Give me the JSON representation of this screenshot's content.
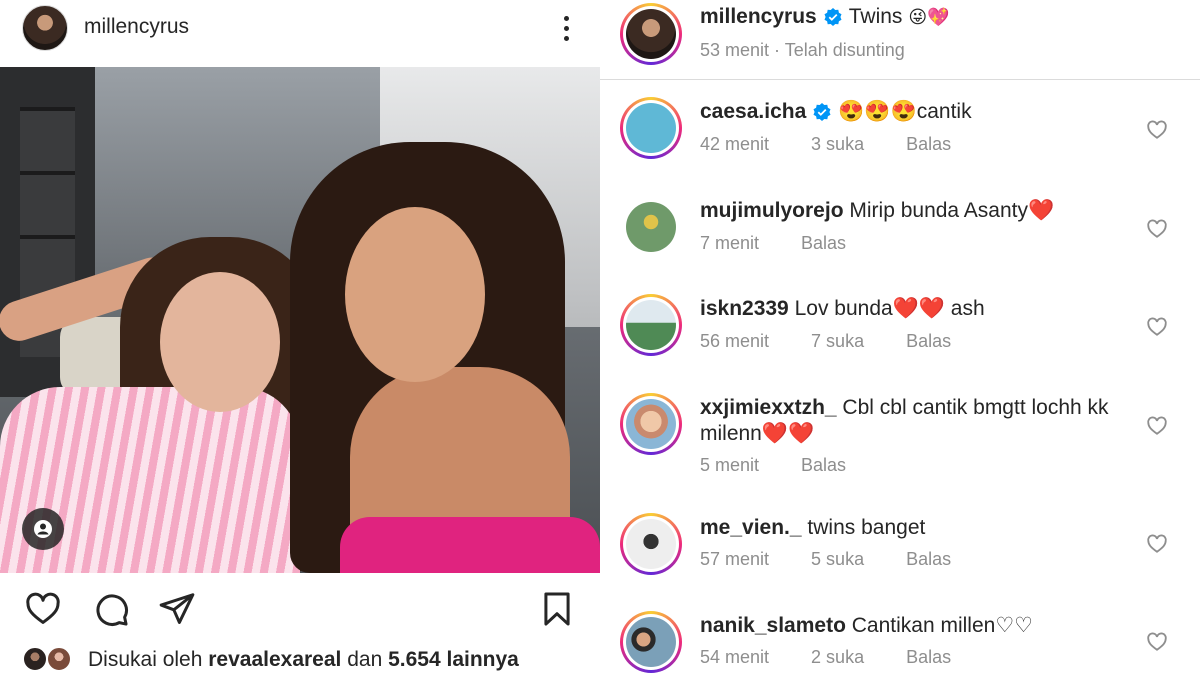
{
  "post": {
    "username": "millencyrus",
    "liked_by_prefix": "Disukai oleh ",
    "liked_by_user": "revaalexareal",
    "liked_by_conj": " dan ",
    "liked_by_count": "5.654 lainnya"
  },
  "caption": {
    "username": "millencyrus",
    "text": "Twins",
    "emojis": "😜💖",
    "meta": "53 menit · Telah disunting"
  },
  "comments": [
    {
      "username": "caesa.icha",
      "verified": true,
      "text": "😍😍😍cantik",
      "time": "42 menit",
      "likes": "3 suka",
      "reply": "Balas",
      "color": "#5fb8d6"
    },
    {
      "username": "mujimulyorejo",
      "verified": false,
      "text": "Mirip bunda Asanty❤️",
      "time": "7 menit",
      "likes": "",
      "reply": "Balas",
      "color": "#6f9a6a"
    },
    {
      "username": "iskn2339",
      "verified": false,
      "text": "Lov bunda❤️❤️ ash",
      "time": "56 menit",
      "likes": "7 suka",
      "reply": "Balas",
      "color": "#4f8a55"
    },
    {
      "username": "xxjimiexxtzh_",
      "verified": false,
      "text": "Cbl cbl cantik bmgtt lochh kk milenn❤️❤️",
      "time": "5 menit",
      "likes": "",
      "reply": "Balas",
      "color": "#c98a6e"
    },
    {
      "username": "me_vien._",
      "verified": false,
      "text": "twins banget",
      "time": "57 menit",
      "likes": "5 suka",
      "reply": "Balas",
      "color": "#9a9a9a"
    },
    {
      "username": "nanik_slameto",
      "verified": false,
      "text": "Cantikan millen♡♡",
      "time": "54 menit",
      "likes": "2 suka",
      "reply": "Balas",
      "color": "#8a6a5a"
    }
  ],
  "colors": {
    "verified_blue": "#0095f6",
    "meta_gray": "#8e8e8e",
    "text": "#262626"
  }
}
